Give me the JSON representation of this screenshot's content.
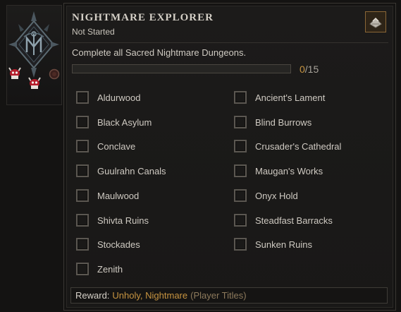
{
  "achievement": {
    "title": "NIGHTMARE EXPLORER",
    "status": "Not Started",
    "description": "Complete all Sacred Nightmare Dungeons.",
    "progress": {
      "current": "0",
      "total": "/15",
      "fraction": 0
    }
  },
  "dungeons": {
    "left": [
      "Aldurwood",
      "Black Asylum",
      "Conclave",
      "Guulrahn Canals",
      "Maulwood",
      "Shivta Ruins",
      "Stockades",
      "Zenith"
    ],
    "right": [
      "Ancient's Lament",
      "Blind Burrows",
      "Crusader's Cathedral",
      "Maugan's Works",
      "Onyx Hold",
      "Steadfast Barracks",
      "Sunken Ruins"
    ]
  },
  "reward": {
    "label": "Reward:",
    "value": "Unholy, Nightmare",
    "category": "(Player Titles)"
  },
  "icons": {
    "emblem": "nightmare-sigil-icon",
    "corner": "armor-cache-icon",
    "skulls": "demon-skull-icon",
    "pip": "locked-pip-icon"
  },
  "colors": {
    "accent": "#c79440",
    "text": "#cfcac2",
    "border": "#3a3733",
    "skull_red": "#b51c2a"
  }
}
